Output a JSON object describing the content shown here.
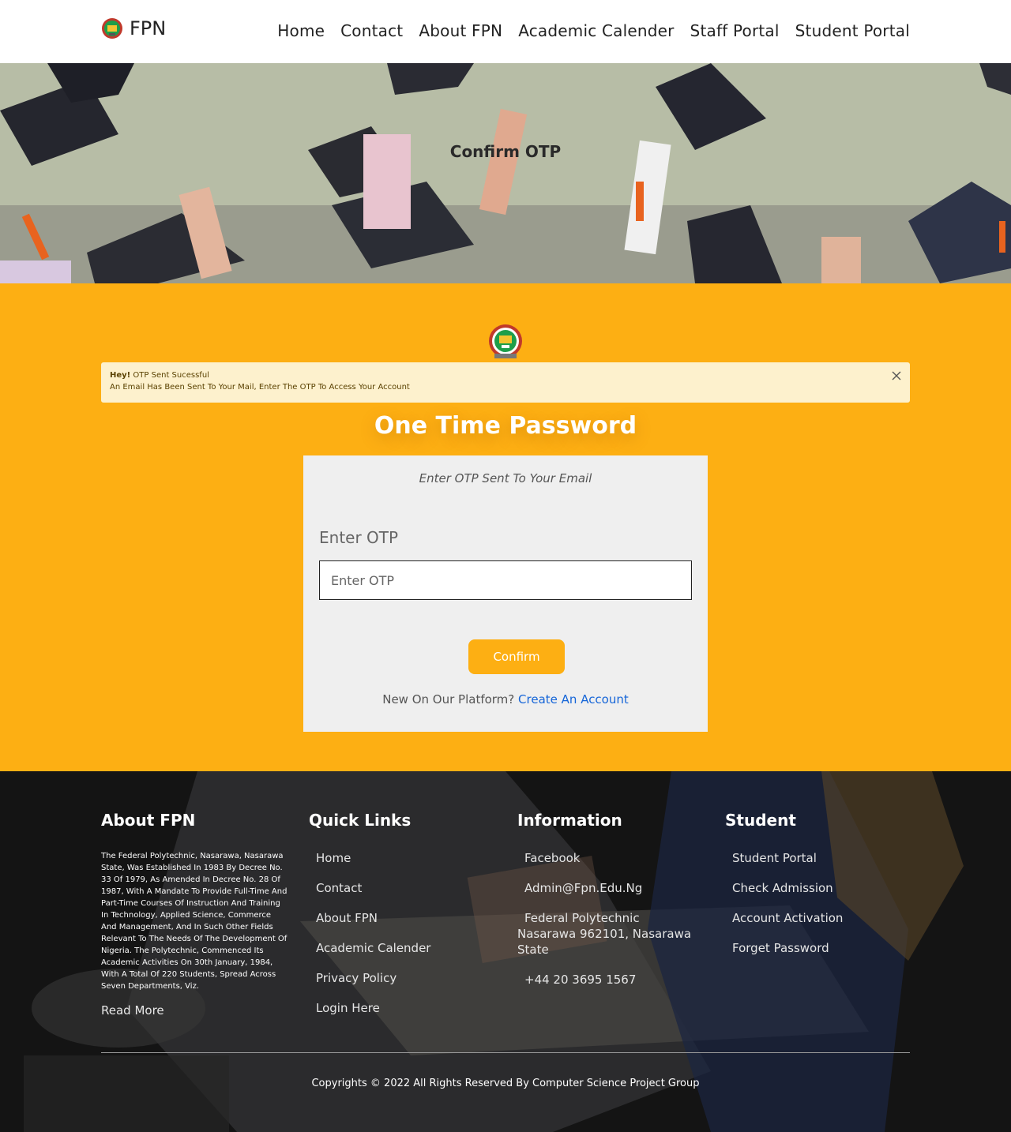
{
  "header": {
    "brand": "FPN",
    "nav": [
      "Home",
      "Contact",
      "About FPN",
      "Academic Calender",
      "Staff Portal",
      "Student Portal"
    ]
  },
  "hero": {
    "title": "Confirm OTP"
  },
  "alert": {
    "strong": "Hey!",
    "message": "OTP Sent Sucessful",
    "detail": "An Email Has Been Sent To Your Mail, Enter The OTP To Access Your Account"
  },
  "otp": {
    "heading": "One Time Password",
    "subtitle": "Enter OTP Sent To Your Email",
    "label": "Enter OTP",
    "placeholder": "Enter OTP",
    "button": "Confirm",
    "signup_prompt": "New On Our Platform?",
    "signup_link": "Create An Account"
  },
  "footer": {
    "about": {
      "title": "About FPN",
      "text": "The Federal Polytechnic, Nasarawa, Nasarawa State, Was Established In 1983 By Decree No. 33 Of 1979, As Amended In Decree No. 28 Of 1987, With A Mandate To Provide Full-Time And Part-Time Courses Of Instruction And Training In Technology, Applied Science, Commerce And Management, And In Such Other Fields Relevant To The Needs Of The Development Of Nigeria. The Polytechnic, Commenced Its Academic Activities On 30th January, 1984, With A Total Of 220 Students, Spread Across Seven Departments, Viz.",
      "read_more": "Read More"
    },
    "quick_links": {
      "title": "Quick Links",
      "items": [
        "Home",
        "Contact",
        "About FPN",
        "Academic Calender",
        "Privacy Policy",
        "Login Here"
      ]
    },
    "information": {
      "title": "Information",
      "facebook": "Facebook",
      "email": "Admin@Fpn.Edu.Ng",
      "address": "Federal Polytechnic Nasarawa 962101, Nasarawa State",
      "phone": "+44 20 3695 1567"
    },
    "student": {
      "title": "Student",
      "items": [
        "Student Portal",
        "Check Admission",
        "Account Activation",
        "Forget Password"
      ]
    },
    "copyright": "Copyrights © 2022 All Rights Reserved By Computer Science Project Group"
  },
  "colors": {
    "accent": "#fdaf13",
    "alert_bg": "#fdf1cd",
    "link": "#1565d8",
    "footer_bg": "#1d1d1d"
  }
}
